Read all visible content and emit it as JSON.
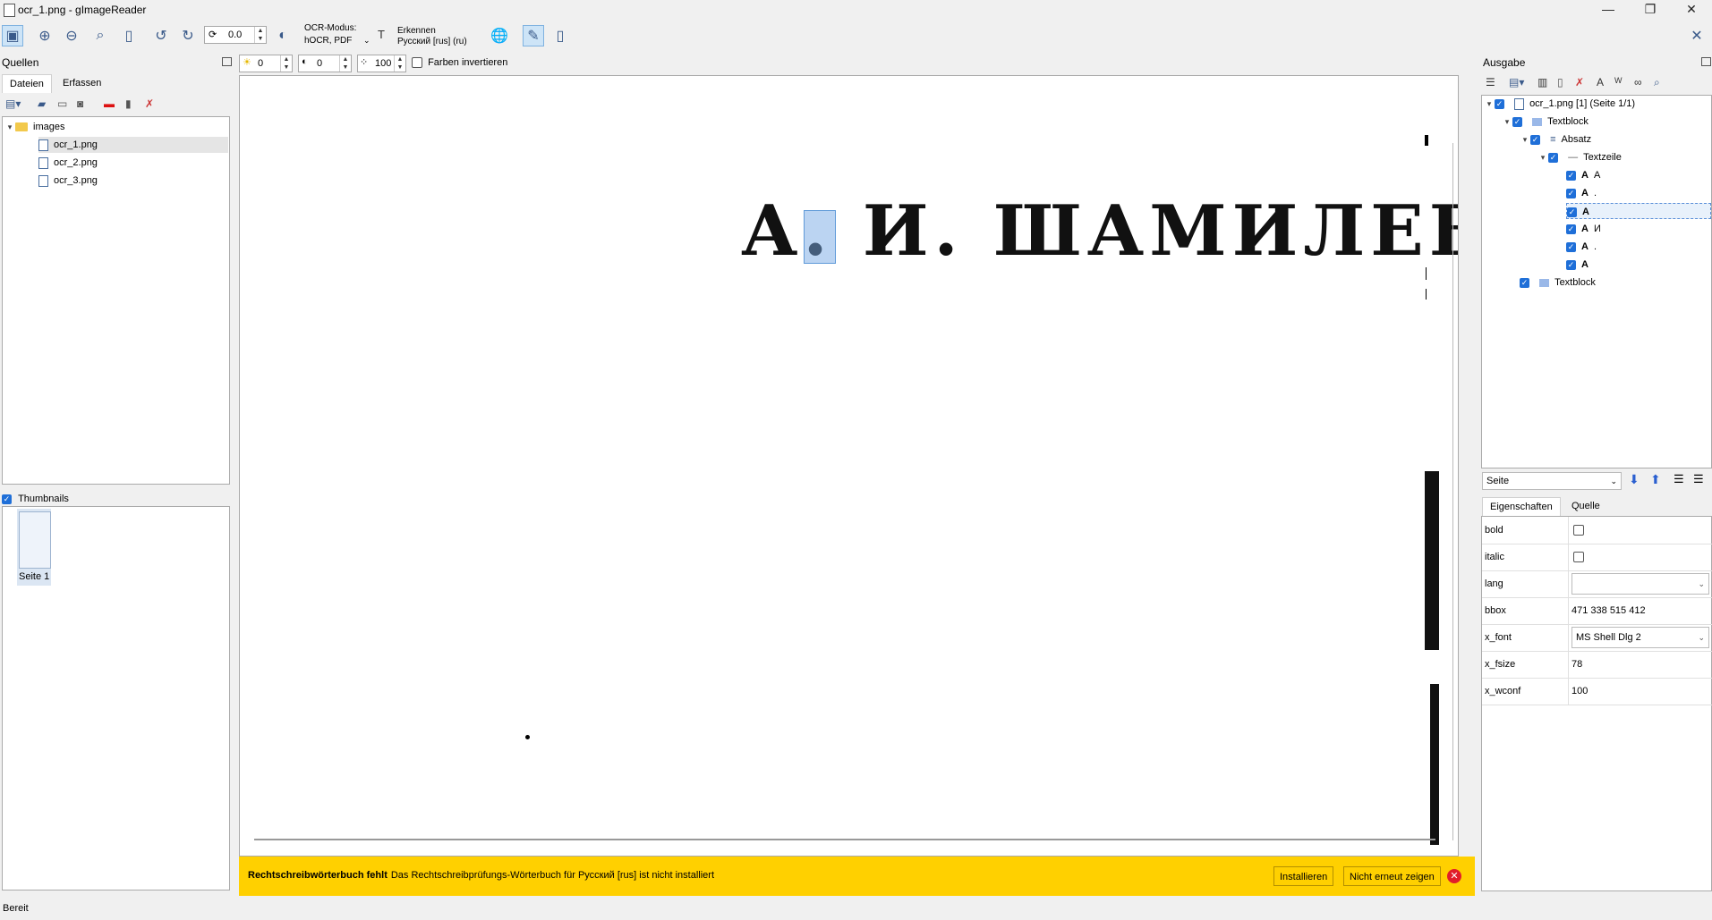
{
  "window": {
    "title": "ocr_1.png - gImageReader"
  },
  "toolbar": {
    "rotation_value": "0.0",
    "ocr_mode_label": "OCR-Modus:",
    "ocr_mode_value": "hOCR, PDF",
    "recognize_label": "Erkennen",
    "recognize_lang": "Русский [rus] (ru)"
  },
  "sources": {
    "title": "Quellen",
    "tabs": [
      "Dateien",
      "Erfassen"
    ],
    "tree": {
      "folder": "images",
      "files": [
        "ocr_1.png",
        "ocr_2.png",
        "ocr_3.png"
      ]
    },
    "thumbnails_label": "Thumbnails",
    "thumbnail_page": "Seite 1"
  },
  "image_toolbar": {
    "brightness": "0",
    "contrast": "0",
    "resolution": "100",
    "invert_label": "Farben invertieren"
  },
  "canvas": {
    "ocr_text": "А. И. ШАМИЛЕВ"
  },
  "notification": {
    "title": "Rechtschreibwörterbuch fehlt",
    "message": "Das Rechtschreibprüfungs-Wörterbuch für Русский [rus] ist nicht installiert",
    "install_label": "Installieren",
    "dont_show_label": "Nicht erneut zeigen"
  },
  "output": {
    "title": "Ausgabe",
    "tree": {
      "root": "ocr_1.png [1] (Seite 1/1)",
      "textblock": "Textblock",
      "absatz": "Absatz",
      "textzeile": "Textzeile",
      "words": [
        "А",
        ".",
        "",
        "И",
        ".",
        ""
      ],
      "textblock2": "Textblock"
    },
    "page_select": "Seite",
    "prop_tabs": [
      "Eigenschaften",
      "Quelle"
    ],
    "properties": {
      "bold": {
        "key": "bold"
      },
      "italic": {
        "key": "italic"
      },
      "lang": {
        "key": "lang",
        "value": ""
      },
      "bbox": {
        "key": "bbox",
        "value": "471 338 515 412"
      },
      "x_font": {
        "key": "x_font",
        "value": "MS Shell Dlg 2"
      },
      "x_fsize": {
        "key": "x_fsize",
        "value": "78"
      },
      "x_wconf": {
        "key": "x_wconf",
        "value": "100"
      }
    }
  },
  "status": {
    "text": "Bereit"
  }
}
